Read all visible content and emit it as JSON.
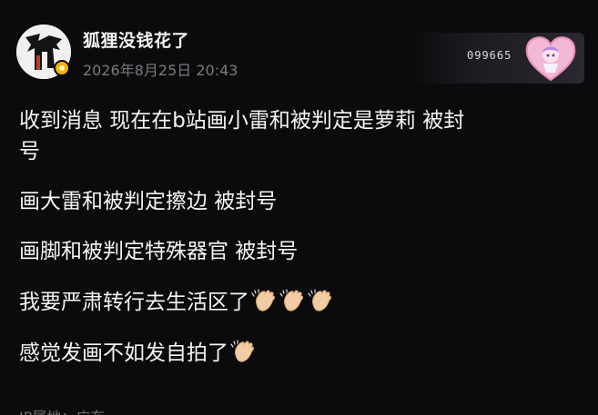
{
  "post": {
    "username": "狐狸没钱花了",
    "timestamp": "2026年8月25日 20:43",
    "avatar_icon": "avatar-icon",
    "badge_icon": "verified-badge-icon",
    "fan_badge": {
      "number": "099665",
      "icon": "heart-character-icon",
      "accent": "#f2b8d4"
    },
    "content_lines": [
      "收到消息 现在在b站画小雷和被判定是萝莉 被封",
      "号",
      "画大雷和被判定擦边 被封号",
      "画脚和被判定特殊器官 被封号",
      "我要严肃转行去生活区了",
      "感觉发画不如发自拍了"
    ],
    "emoji_icon": "clapping-hands-icon",
    "ip_location": "IP属地：广东"
  },
  "colors": {
    "background": "#0b0b0d",
    "text": "#f5f5f5",
    "muted": "#7a7a7e",
    "badge": "#f4b400"
  }
}
